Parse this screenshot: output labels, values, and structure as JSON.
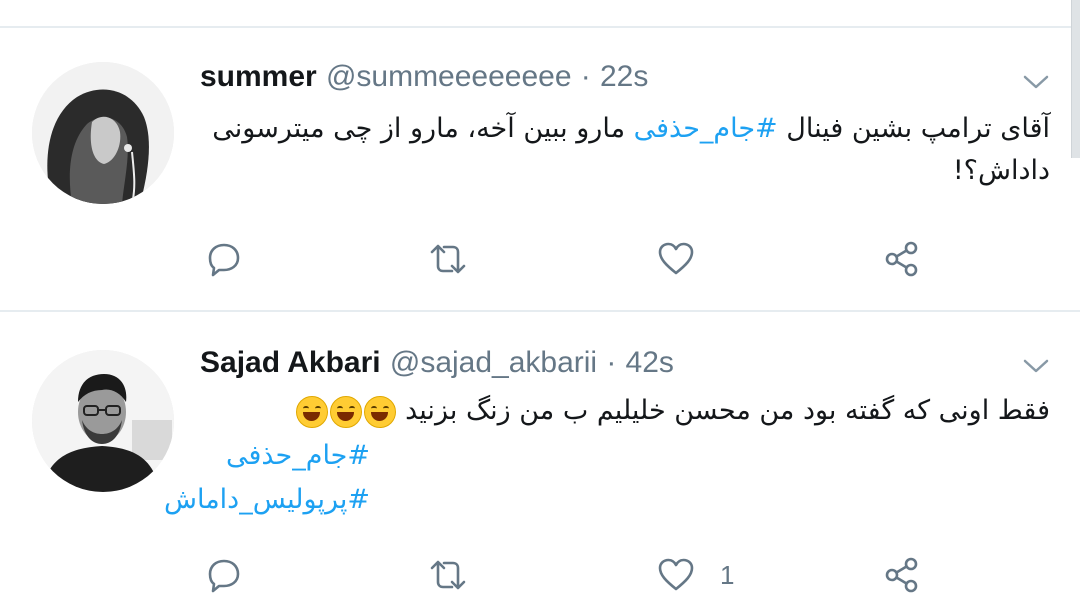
{
  "tweets": [
    {
      "display_name": "summer",
      "handle": "@summeeeeeeee",
      "separator": "·",
      "time": "22s",
      "text_before": "آقای ترامپ بشین فینال ",
      "hashtag": "#جام_حذفی",
      "text_after": " مارو ببین آخه، مارو از چی میترسونی داداش؟!",
      "like_count": ""
    },
    {
      "display_name": "Sajad Akbari",
      "handle": "@sajad_akbarii",
      "separator": "·",
      "time": "42s",
      "text": "فقط اونی که گفته بود من محسن خلیلیم ب من زنگ بزنید",
      "emoji_name": "face-with-tears-of-joy",
      "hashtags": [
        "#جام_حذفی",
        "#پرپولیس_داماش"
      ],
      "like_count": "1"
    }
  ],
  "icons": {
    "reply": "reply-icon",
    "retweet": "retweet-icon",
    "like": "heart-icon",
    "share": "share-icon",
    "more": "chevron-down-icon"
  },
  "colors": {
    "accent": "#1da1f2",
    "muted": "#657786",
    "text": "#14171a",
    "divider": "#e6ecf0"
  }
}
